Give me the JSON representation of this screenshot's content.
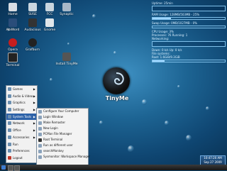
{
  "desktop": {
    "icons": [
      {
        "label": "Home",
        "icon": "home-folder-icon",
        "color": "#d8dde3"
      },
      {
        "label": "SUSE",
        "icon": "suse-icon",
        "color": "#c9d6df"
      },
      {
        "label": "FCC",
        "icon": "fcc-icon",
        "color": "#c9d6df"
      },
      {
        "label": "Synaptic",
        "icon": "synaptic-icon",
        "color": "#a8b8c8"
      },
      {
        "label": "AbiWord",
        "icon": "abiword-icon",
        "color": "#2a4d7a"
      },
      {
        "label": "Audacious",
        "icon": "audacious-icon",
        "color": "#333333"
      },
      {
        "label": "Gnome",
        "icon": "gnome-icon",
        "color": "#e0e6ea"
      },
      {
        "label": "Opera",
        "icon": "opera-icon",
        "color": "#c61e1e"
      },
      {
        "label": "Grafburn",
        "icon": "grafburn-icon",
        "color": "#222222"
      },
      {
        "label": "Terminal",
        "icon": "terminal-icon",
        "color": "#222222"
      },
      {
        "label": "Install TinyMe",
        "icon": "install-icon",
        "color": "#555555"
      }
    ]
  },
  "conky": {
    "lines": [
      "Uptime: 25min",
      "RAM Usage: 128MB/503MB - 25%",
      "Swap Usage: 0MB/1027MB - 0%",
      "CPU Usage: 3%",
      "Processes: 76  Running: 1",
      "Networking:",
      "Down: 0 k/s   Up: 0 k/s",
      "File systems:",
      "Root: 1.6GiB/9.3GiB"
    ],
    "ram_level": 0.25,
    "swap_level": 0.0,
    "root_level": 0.17
  },
  "logo": {
    "text": "TinyMe"
  },
  "start_menu": {
    "items": [
      {
        "label": "Games",
        "has_submenu": true
      },
      {
        "label": "Audio & Video",
        "has_submenu": true
      },
      {
        "label": "Graphics",
        "has_submenu": true
      },
      {
        "label": "Settings",
        "has_submenu": true
      },
      {
        "label": "System Tools",
        "has_submenu": true,
        "active": true
      },
      {
        "label": "Network",
        "has_submenu": true
      },
      {
        "label": "Office",
        "has_submenu": true
      },
      {
        "label": "Accessories",
        "has_submenu": true
      },
      {
        "label": "Run",
        "has_submenu": false
      },
      {
        "label": "Preferences",
        "has_submenu": false
      },
      {
        "label": "Logout",
        "has_submenu": false
      }
    ]
  },
  "submenu": {
    "items": [
      {
        "label": "Configure Your Computer"
      },
      {
        "label": "Login Window"
      },
      {
        "label": "Make Remaster"
      },
      {
        "label": "New Login"
      },
      {
        "label": "PCMan File Manager"
      },
      {
        "label": "Root Terminal"
      },
      {
        "label": "Run as different user"
      },
      {
        "label": "searchMonkey"
      },
      {
        "label": "Sysmonitor: Workspace Manager"
      }
    ]
  },
  "taskbar": {
    "clock_time": "10:47:20 AM",
    "clock_date": "Sep 27 2009",
    "menu_arrow": "▶"
  }
}
